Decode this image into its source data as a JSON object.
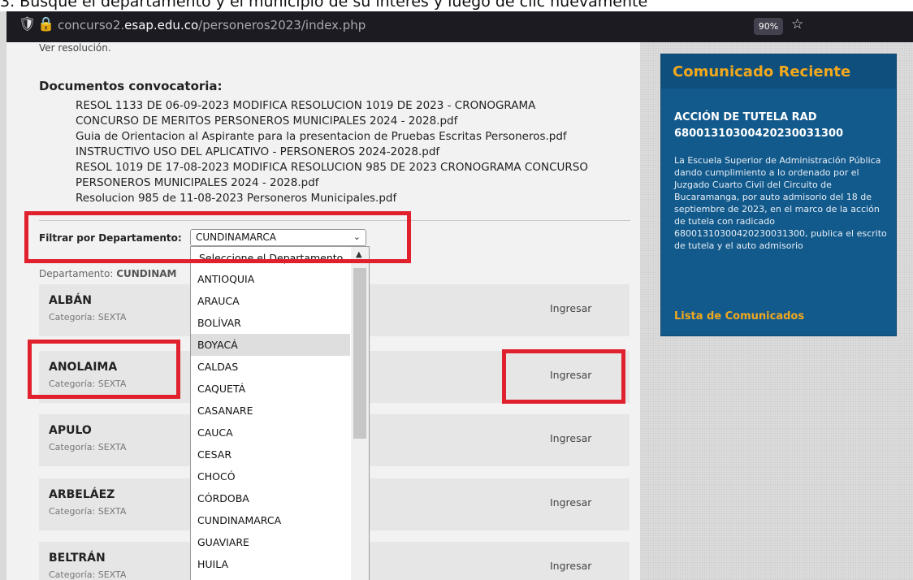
{
  "caption": "3. Busque el departamento y el municipio de su interés y luego de clic nuevamente",
  "browser": {
    "url_host": "concurso2.",
    "url_domain": "esap.edu.co",
    "url_path": "/personeros2023/index.php",
    "zoom": "90%"
  },
  "main": {
    "ver_resolucion": "Ver resolución.",
    "documents_title": "Documentos convocatoria:",
    "documents": [
      "RESOL 1133 DE 06-09-2023 MODIFICA RESOLUCION 1019 DE 2023 - CRONOGRAMA",
      "CONCURSO DE MERITOS PERSONEROS MUNICIPALES 2024 - 2028.pdf",
      "Guia de Orientacion al Aspirante para la presentacion de Pruebas Escritas Personeros.pdf",
      "INSTRUCTIVO USO DEL APLICATIVO - PERSONEROS 2024-2028.pdf",
      "RESOL 1019 DE 17-08-2023 MODIFICA RESOLUCION 985 DE 2023 CRONOGRAMA CONCURSO",
      "PERSONEROS MUNICIPALES 2024 - 2028.pdf",
      "Resolucion 985 de 11-08-2023 Personeros Municipales.pdf"
    ],
    "filter_label": "Filtrar por Departamento:",
    "filter_value": "CUNDINAMARCA",
    "department_label": "Departamento:",
    "department_value": "CUNDINAM",
    "municipalities": [
      {
        "name": "ALBÁN",
        "category": "Categoría: SEXTA",
        "action": "Ingresar"
      },
      {
        "name": "ANOLAIMA",
        "category": "Categoría: SEXTA",
        "action": "Ingresar"
      },
      {
        "name": "APULO",
        "category": "Categoría: SEXTA",
        "action": "Ingresar"
      },
      {
        "name": "ARBELÁEZ",
        "category": "Categoría: SEXTA",
        "action": "Ingresar"
      },
      {
        "name": "BELTRÁN",
        "category": "Categoría: SEXTA",
        "action": "Ingresar"
      }
    ]
  },
  "dropdown": {
    "placeholder": "Seleccione el Departamento",
    "options": [
      "ANTIOQUIA",
      "ARAUCA",
      "BOLÍVAR",
      "BOYACÁ",
      "CALDAS",
      "CAQUETÁ",
      "CASANARE",
      "CAUCA",
      "CESAR",
      "CHOCÓ",
      "CÓRDOBA",
      "CUNDINAMARCA",
      "GUAVIARE",
      "HUILA"
    ],
    "highlighted": "BOYACÁ"
  },
  "panel": {
    "heading": "Comunicado Reciente",
    "title": "ACCIÓN DE TUTELA RAD 68001310300420230031300",
    "body": "La Escuela Superior de Administración Pública dando cumplimiento a lo ordenado por el Juzgado Cuarto Civil del Circuito de Bucaramanga, por auto admisorio del 18 de septiembre de 2023, en el marco de la acción de tutela con radicado 68001310300420230031300, publica el escrito de tutela y el auto admisorio",
    "link": "Lista de Comunicados"
  },
  "colors": {
    "highlight": "#e0202c",
    "panel_bg": "#135a8c",
    "panel_accent": "#f2a81d"
  },
  "icons": [
    "shield-icon",
    "lock-icon",
    "star-icon",
    "chevron-down-icon"
  ]
}
